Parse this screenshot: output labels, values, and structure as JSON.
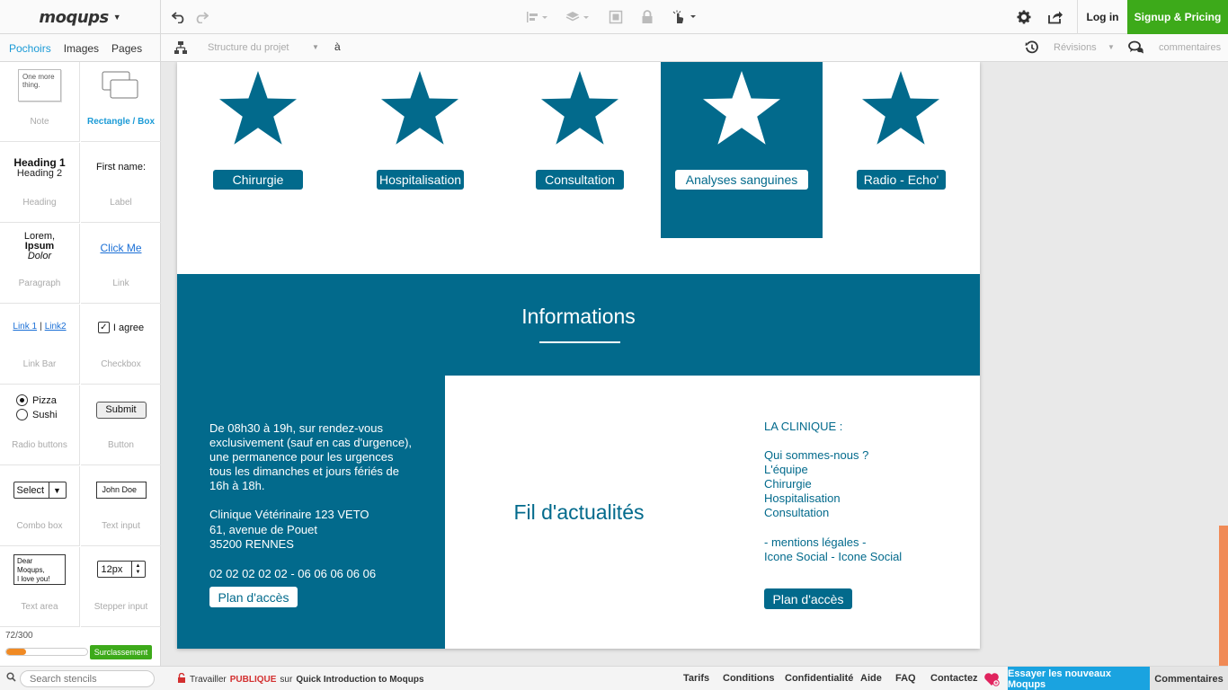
{
  "app": {
    "logo": "moqups",
    "login": "Log in",
    "signup": "Signup & Pricing"
  },
  "toolbar": {
    "icons": [
      "undo-icon",
      "redo-icon",
      "align-icon",
      "layers-icon",
      "group-icon",
      "lock-icon",
      "interaction-icon",
      "settings-icon",
      "share-icon"
    ]
  },
  "subbar": {
    "tabs": [
      "Pochoirs",
      "Images",
      "Pages"
    ],
    "active_tab": "Pochoirs",
    "structure": "Structure du projet",
    "page": "à",
    "revisions": "Révisions",
    "comments": "commentaires"
  },
  "stencils": {
    "items": [
      "Note",
      "Rectangle / Box",
      "Heading",
      "Label",
      "Paragraph",
      "Link",
      "Link Bar",
      "Checkbox",
      "Radio buttons",
      "Button",
      "Combo box",
      "Text input",
      "Text area",
      "Stepper input"
    ],
    "active": "Rectangle / Box",
    "previews": {
      "note": "One more thing.",
      "heading1": "Heading 1",
      "heading2": "Heading 2",
      "label": "First name:",
      "para1": "Lorem,",
      "para2": "Ipsum",
      "para3": "Dolor",
      "link": "Click Me",
      "link1": "Link 1",
      "sep": "|",
      "link2": "Link2",
      "checkbox": "I agree",
      "radio1": "Pizza",
      "radio2": "Sushi",
      "button": "Submit",
      "select": "Select",
      "textinput": "John Doe",
      "textarea1": "Dear Moqups,",
      "textarea2": "I love you!",
      "stepper": "12px"
    },
    "usage": "72/300",
    "usage_fraction": 0.24,
    "upgrade": "Surclassement",
    "search_placeholder": "Search stencils"
  },
  "footer": {
    "work_prefix": "Travailler",
    "public": "PUBLIQUE",
    "on": "sur",
    "project": "Quick Introduction to Moqups",
    "links": [
      "Tarifs",
      "Conditions",
      "Confidentialité",
      "Aide",
      "FAQ",
      "Contactez"
    ],
    "try_new": "Essayer les nouveaux Moqups",
    "comments": "Commentaires"
  },
  "mockup": {
    "services": [
      {
        "label": "Chirurgie",
        "selected": false
      },
      {
        "label": "Hospitalisation",
        "selected": false
      },
      {
        "label": "Consultation",
        "selected": false
      },
      {
        "label": "Analyses sanguines",
        "selected": true
      },
      {
        "label": "Radio - Echo'",
        "selected": false
      }
    ],
    "info_title": "Informations",
    "hours": [
      "De 08h30 à 19h, sur rendez-vous",
      "exclusivement (sauf en cas d'urgence),",
      "une permanence pour les urgences",
      "tous les dimanches et jours fériés de",
      "16h à 18h.",
      "Clinique Vétérinaire 123 VETO",
      "61, avenue de Pouet",
      "35200 RENNES",
      "02 02 02 02 02 - 06 06 06 06 06"
    ],
    "plan_btn": "Plan d'accès",
    "news_title": "Fil d'actualités",
    "clinic": [
      "LA CLINIQUE :",
      "Qui sommes-nous ?",
      "L'équipe",
      "Chirurgie",
      "Hospitalisation",
      "Consultation",
      "- mentions légales -",
      "Icone Social - Icone Social"
    ],
    "colors": {
      "brand": "#026a8c",
      "signup": "#3daa1a",
      "try_new": "#1aa3e0",
      "public": "#d32f2f"
    }
  }
}
